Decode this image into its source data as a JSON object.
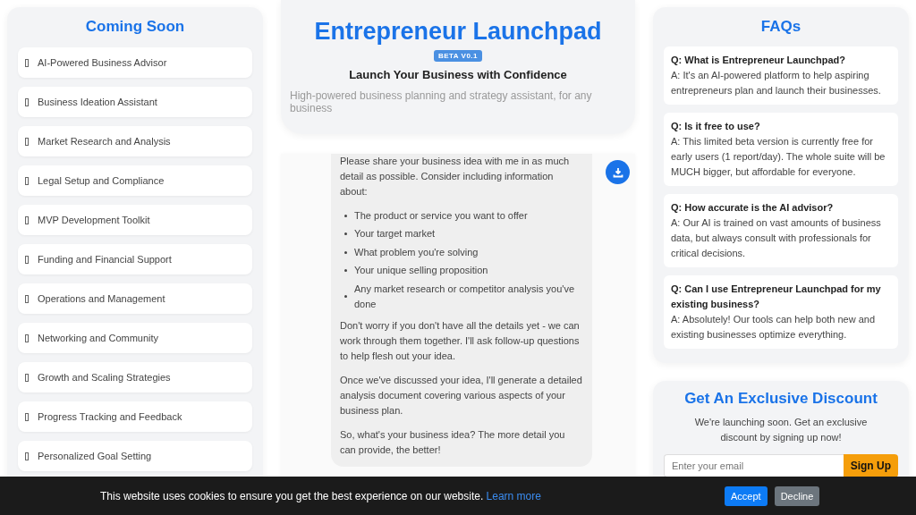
{
  "sidebar": {
    "title": "Coming Soon",
    "items": [
      {
        "label": "AI-Powered Business Advisor"
      },
      {
        "label": "Business Ideation Assistant"
      },
      {
        "label": "Market Research and Analysis"
      },
      {
        "label": "Legal Setup and Compliance"
      },
      {
        "label": "MVP Development Toolkit"
      },
      {
        "label": "Funding and Financial Support"
      },
      {
        "label": "Operations and Management"
      },
      {
        "label": "Networking and Community"
      },
      {
        "label": "Growth and Scaling Strategies"
      },
      {
        "label": "Progress Tracking and Feedback"
      },
      {
        "label": "Personalized Goal Setting"
      }
    ]
  },
  "header": {
    "title": "Entrepreneur Launchpad",
    "badge": "BETA V0.1",
    "subtitle": "Launch Your Business with Confidence",
    "tagline": "High-powered business planning and strategy assistant, for any business"
  },
  "chat": {
    "message": {
      "intro": "Please share your business idea with me in as much detail as possible. Consider including information about:",
      "bullets": [
        "The product or service you want to offer",
        "Your target market",
        "What problem you're solving",
        "Your unique selling proposition",
        "Any market research or competitor analysis you've done"
      ],
      "paragraphs": [
        "Don't worry if you don't have all the details yet - we can work through them together. I'll ask follow-up questions to help flesh out your idea.",
        "Once we've discussed your idea, I'll generate a detailed analysis document covering various aspects of your business plan.",
        "So, what's your business idea? The more detail you can provide, the better!"
      ]
    }
  },
  "faqs": {
    "title": "FAQs",
    "items": [
      {
        "question": "Q: What is Entrepreneur Launchpad?",
        "answer": "A: It's an AI-powered platform to help aspiring entrepreneurs plan and launch their businesses."
      },
      {
        "question": "Q: Is it free to use?",
        "answer": "A: This limited beta version is currently free for early users (1 report/day). The whole suite will be MUCH bigger, but affordable for everyone."
      },
      {
        "question": "Q: How accurate is the AI advisor?",
        "answer": "A: Our AI is trained on vast amounts of business data, but always consult with professionals for critical decisions."
      },
      {
        "question": "Q: Can I use Entrepreneur Launchpad for my existing business?",
        "answer": "A: Absolutely! Our tools can help both new and existing businesses optimize everything."
      }
    ]
  },
  "discount": {
    "title": "Get An Exclusive Discount",
    "text": "We're launching soon. Get an exclusive discount by signing up now!",
    "email_placeholder": "Enter your email",
    "button": "Sign Up"
  },
  "cookie_banner": {
    "text": "This website uses cookies to ensure you get the best experience on our website.",
    "link": "Learn more",
    "buttons": [
      {
        "label": "Accept",
        "kind": "accept"
      },
      {
        "label": "Decline",
        "kind": "decline"
      }
    ]
  }
}
